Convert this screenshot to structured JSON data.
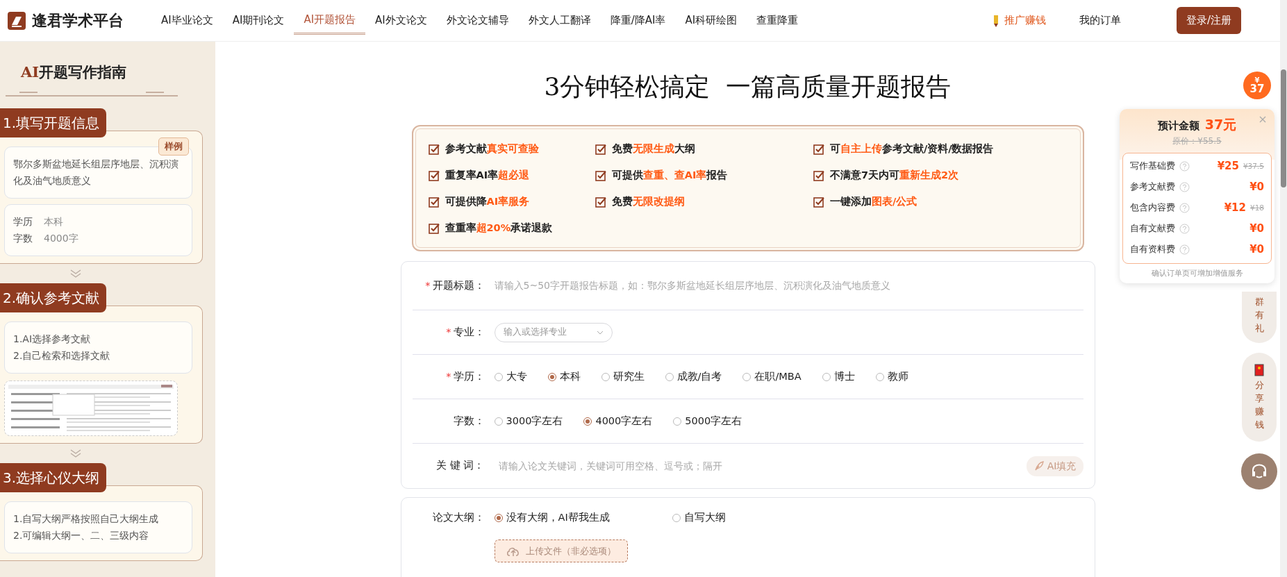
{
  "logo": {
    "text": "逢君学术平台"
  },
  "nav": [
    {
      "label": "AI毕业论文",
      "selected": false
    },
    {
      "label": "AI期刊论文",
      "selected": false
    },
    {
      "label": "AI开题报告",
      "selected": true
    },
    {
      "label": "AI外文论文",
      "selected": false
    },
    {
      "label": "外文论文辅导",
      "selected": false
    },
    {
      "label": "外文人工翻译",
      "selected": false
    },
    {
      "label": "降重/降AI率",
      "selected": false
    },
    {
      "label": "AI科研绘图",
      "selected": false
    },
    {
      "label": "查重降重",
      "selected": false
    }
  ],
  "promo_link": "推广赚钱",
  "orders_link": "我的订单",
  "login_button": "登录/注册",
  "guide": {
    "title_prefix": "AI",
    "title": "开题写作指南",
    "steps": [
      {
        "kind": "sample",
        "heading": "1.填写开题信息",
        "badge": "样例",
        "topic": "鄂尔多斯盆地延长组层序地层、沉积演化及油气地质意义",
        "fields": [
          {
            "label": "学历",
            "value": "本科"
          },
          {
            "label": "字数",
            "value": "4000字"
          }
        ]
      },
      {
        "kind": "list",
        "heading": "2.确认参考文献",
        "lines": [
          "1.AI选择参考文献",
          "2.自己检索和选择文献"
        ],
        "has_screenshot": true
      },
      {
        "kind": "list",
        "heading": "3.选择心仪大纲",
        "lines": [
          "1.自写大纲严格按照自己大纲生成",
          "2.可编辑大纲一、二、三级内容"
        ],
        "has_screenshot": false
      }
    ]
  },
  "headline": "3分钟轻松搞定  一篇高质量开题报告",
  "features": [
    [
      {
        "text": "参考文献"
      },
      {
        "text": "真实可查验",
        "highlight": true
      }
    ],
    [
      {
        "text": "免费"
      },
      {
        "text": "无限生成",
        "highlight": true
      },
      {
        "text": "大纲"
      }
    ],
    [
      {
        "text": "可"
      },
      {
        "text": "自主上传",
        "highlight": true
      },
      {
        "text": "参考文献/资料/数据报告"
      }
    ],
    [
      {
        "text": "重复率AI率"
      },
      {
        "text": "超必退",
        "highlight": true
      }
    ],
    [
      {
        "text": "可提供"
      },
      {
        "text": "查重、查AI率",
        "highlight": true
      },
      {
        "text": "报告"
      }
    ],
    [
      {
        "text": "不满意7天内可"
      },
      {
        "text": "重新生成2次",
        "highlight": true
      }
    ],
    [
      {
        "text": "可提供降"
      },
      {
        "text": "AI率服务",
        "highlight": true
      }
    ],
    [
      {
        "text": "免费"
      },
      {
        "text": "无限改提纲",
        "highlight": true
      }
    ],
    [
      {
        "text": "一键添加"
      },
      {
        "text": "图表/公式",
        "highlight": true
      }
    ],
    [
      {
        "text": "查重率"
      },
      {
        "text": "超20%",
        "highlight": true
      },
      {
        "text": "承诺退款"
      }
    ]
  ],
  "form": [
    {
      "kind": "text",
      "required_mark": "*",
      "label": "开题标题：",
      "placeholder": "请输入5~50字开题报告标题，如：鄂尔多斯盆地延长组层序地层、沉积演化及油气地质意义"
    },
    {
      "kind": "select",
      "required_mark": "*",
      "label": "专业：",
      "placeholder": "输入或选择专业"
    },
    {
      "kind": "radio",
      "required_mark": "*",
      "label": "学历：",
      "options": [
        {
          "label": "大专",
          "selected": false
        },
        {
          "label": "本科",
          "selected": true
        },
        {
          "label": "研究生",
          "selected": false
        },
        {
          "label": "成教/自考",
          "selected": false
        },
        {
          "label": "在职/MBA",
          "selected": false
        },
        {
          "label": "博士",
          "selected": false
        },
        {
          "label": "教师",
          "selected": false
        }
      ]
    },
    {
      "kind": "radio",
      "label": "字数：",
      "options": [
        {
          "label": "3000字左右",
          "selected": false
        },
        {
          "label": "4000字左右",
          "selected": true
        },
        {
          "label": "5000字左右",
          "selected": false
        }
      ]
    },
    {
      "kind": "ai_text",
      "label": "关 键 词：",
      "placeholder": "请输入论文关键词，关键词可用空格、逗号或；隔开",
      "ai_button": "AI填充"
    }
  ],
  "outline": {
    "label": "论文大纲：",
    "options": [
      {
        "label": "没有大纲，AI帮我生成",
        "selected": true
      },
      {
        "label": "自写大纲",
        "selected": false
      }
    ],
    "upload_button": "上传文件（非必选项）"
  },
  "price": {
    "badge_currency": "¥",
    "badge_amount": "37",
    "title": "预计金额",
    "amount": "37元",
    "original": "原价：¥55.5",
    "items": [
      {
        "label": "写作基础费",
        "price": "¥25",
        "original": "¥37.5"
      },
      {
        "label": "参考文献费",
        "price": "¥0"
      },
      {
        "label": "包含内容费",
        "price": "¥12",
        "original": "¥18"
      },
      {
        "label": "自有文献费",
        "price": "¥0"
      },
      {
        "label": "自有资料费",
        "price": "¥0"
      }
    ],
    "note": "确认订单页可增加增值服务"
  },
  "side_buttons": [
    {
      "kind": "text",
      "label": "群有礼"
    },
    {
      "kind": "share",
      "label": "分享赚钱"
    },
    {
      "kind": "support"
    }
  ]
}
